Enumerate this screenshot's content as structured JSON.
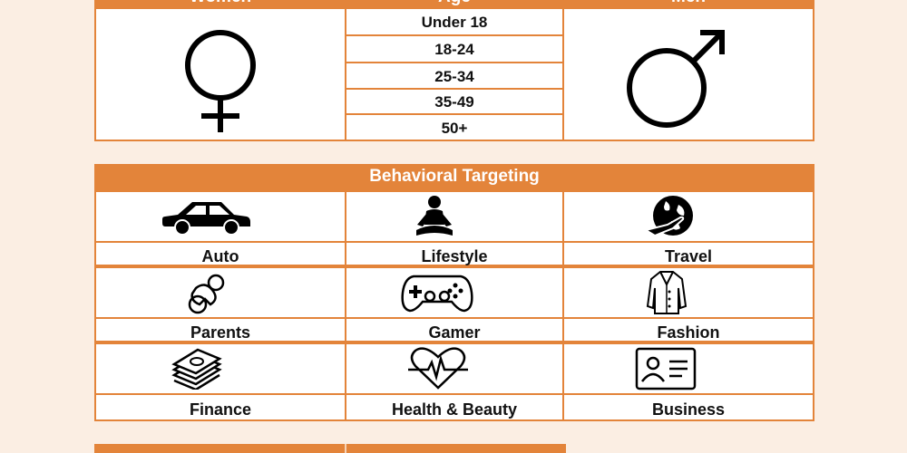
{
  "demographics": {
    "women_header": "Women",
    "age_header": "Age",
    "men_header": "Men",
    "ages": [
      "Under 18",
      "18-24",
      "25-34",
      "35-49",
      "50+"
    ]
  },
  "behavioral": {
    "title": "Behavioral Targeting",
    "categories": [
      {
        "label": "Auto",
        "icon": "car-icon"
      },
      {
        "label": "Lifestyle",
        "icon": "meditation-icon"
      },
      {
        "label": "Travel",
        "icon": "globe-plane-icon"
      },
      {
        "label": "Parents",
        "icon": "pacifier-icon"
      },
      {
        "label": "Gamer",
        "icon": "gamepad-icon"
      },
      {
        "label": "Fashion",
        "icon": "coat-icon"
      },
      {
        "label": "Finance",
        "icon": "money-stack-icon"
      },
      {
        "label": "Health & Beauty",
        "icon": "heartbeat-icon"
      },
      {
        "label": "Business",
        "icon": "id-card-icon"
      }
    ]
  },
  "colors": {
    "accent": "#e3843a",
    "background": "#fbeee3",
    "cell": "#ffffff"
  }
}
